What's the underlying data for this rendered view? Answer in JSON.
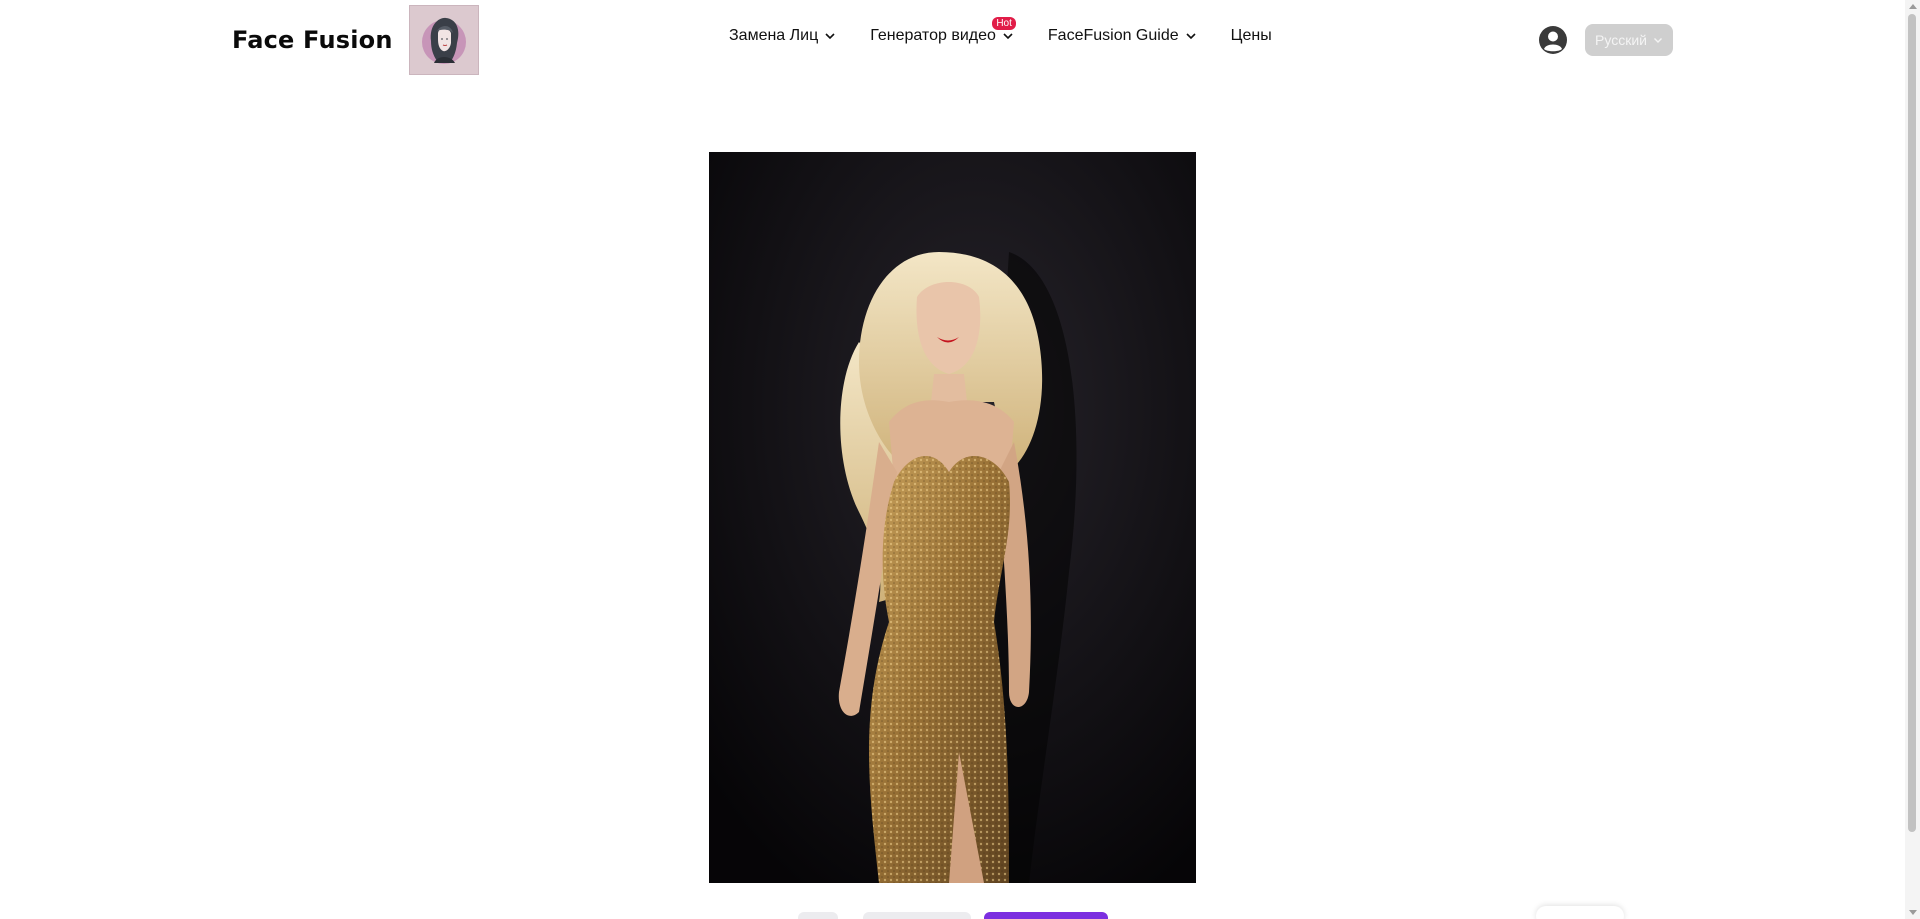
{
  "brand": {
    "title": "Face Fusion"
  },
  "nav": {
    "items": [
      {
        "label": "Замена Лиц",
        "has_dropdown": true
      },
      {
        "label": "Генератор видео",
        "has_dropdown": true,
        "badge": "Hot"
      },
      {
        "label": "FaceFusion Guide",
        "has_dropdown": true
      },
      {
        "label": "Цены",
        "has_dropdown": false
      }
    ]
  },
  "header": {
    "language": "Русский",
    "user_icon": "user-circle-icon"
  },
  "colors": {
    "accent": "#7c2fe0",
    "hot_badge": "#e11d48",
    "lang_button_bg": "#cfcfcf"
  },
  "main": {
    "image_subject": "woman in gold sequin dress"
  }
}
